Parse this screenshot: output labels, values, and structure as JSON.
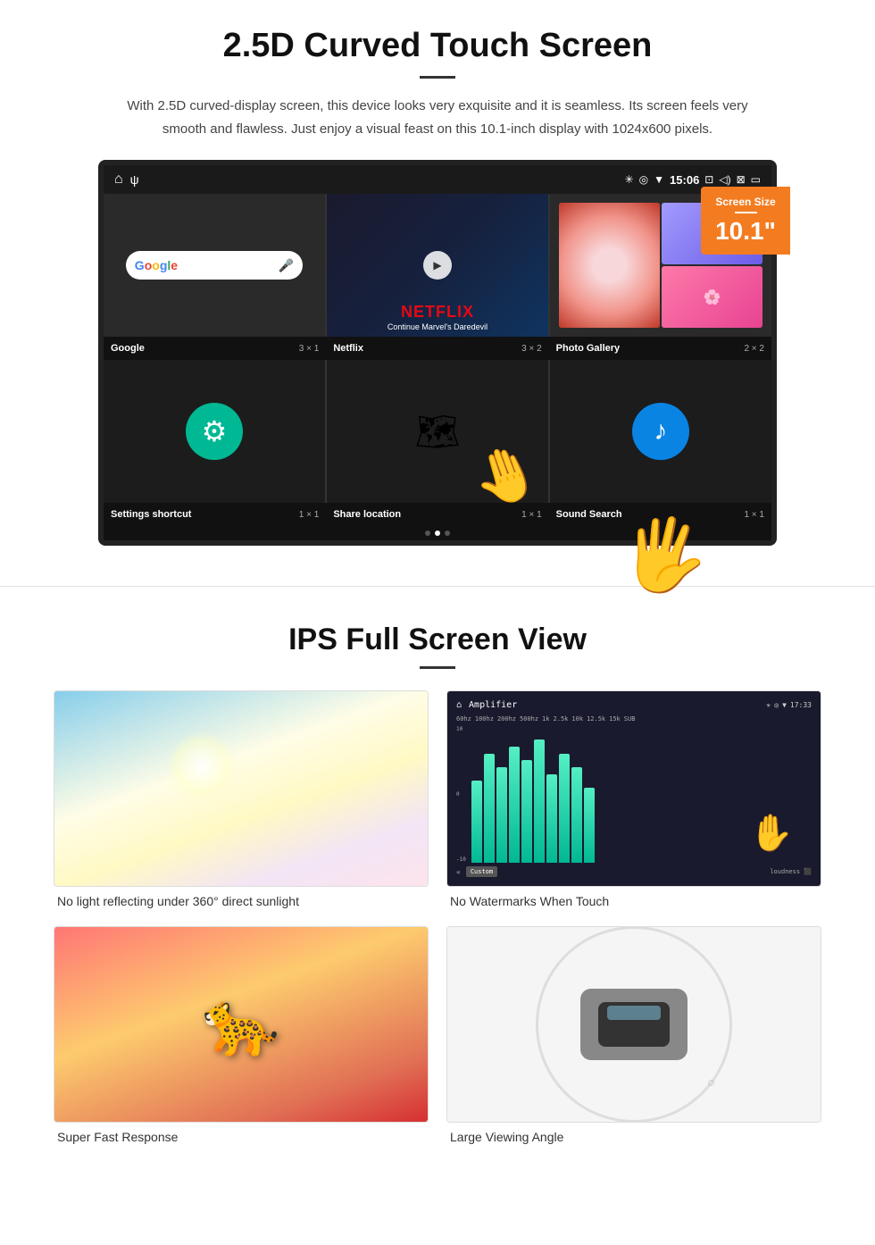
{
  "section1": {
    "title": "2.5D Curved Touch Screen",
    "description": "With 2.5D curved-display screen, this device looks very exquisite and it is seamless. Its screen feels very smooth and flawless. Just enjoy a visual feast on this 10.1-inch display with 1024x600 pixels.",
    "badge": {
      "label": "Screen Size",
      "size": "10.1\""
    },
    "status_bar": {
      "time": "15:06"
    },
    "apps": {
      "row1": [
        {
          "name": "Google",
          "size": "3 × 1"
        },
        {
          "name": "Netflix",
          "size": "3 × 2"
        },
        {
          "name": "Photo Gallery",
          "size": "2 × 2"
        }
      ],
      "row2": [
        {
          "name": "Settings shortcut",
          "size": "1 × 1"
        },
        {
          "name": "Share location",
          "size": "1 × 1"
        },
        {
          "name": "Sound Search",
          "size": "1 × 1"
        }
      ]
    },
    "netflix": {
      "logo": "NETFLIX",
      "subtitle": "Continue Marvel's Daredevil"
    }
  },
  "section2": {
    "title": "IPS Full Screen View",
    "features": [
      {
        "label": "No light reflecting under 360° direct sunlight",
        "image_type": "sunlight"
      },
      {
        "label": "No Watermarks When Touch",
        "image_type": "amplifier"
      },
      {
        "label": "Super Fast Response",
        "image_type": "cheetah"
      },
      {
        "label": "Large Viewing Angle",
        "image_type": "car"
      }
    ]
  }
}
